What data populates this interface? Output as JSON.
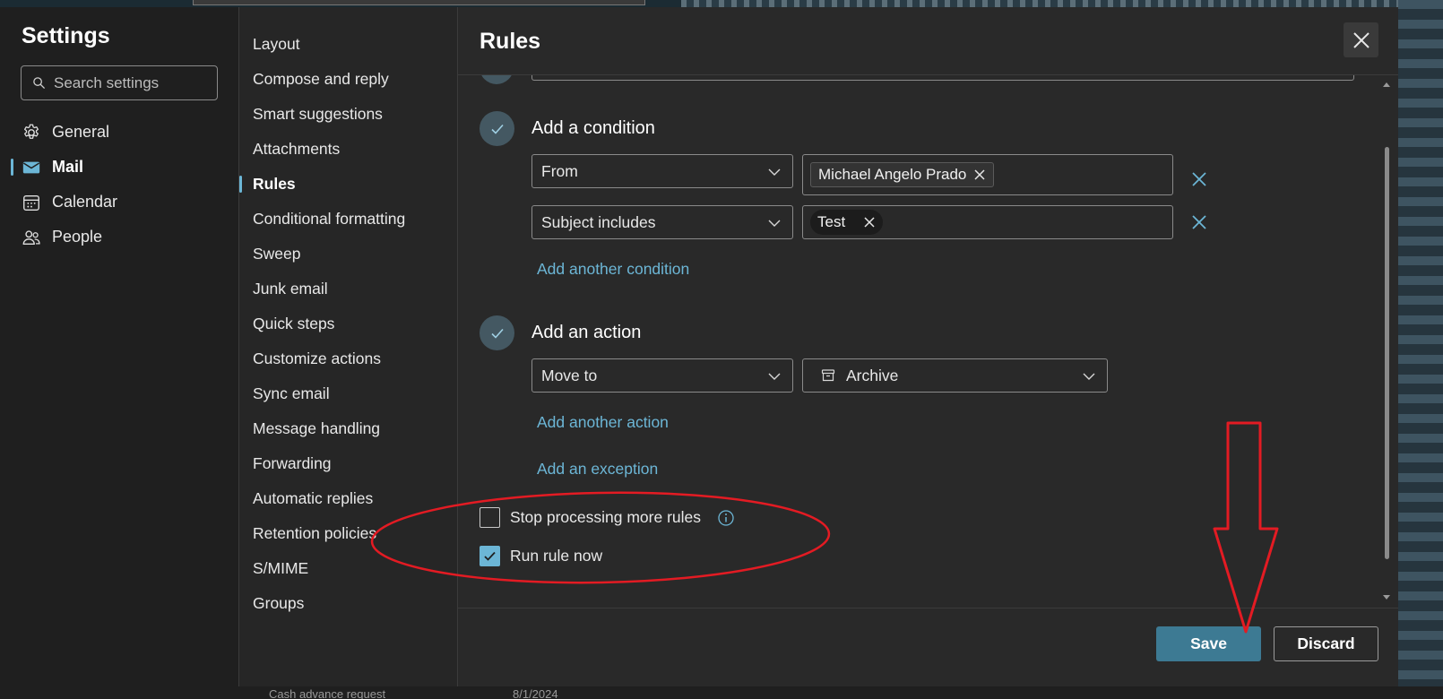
{
  "background": {
    "row_text": "Cash advance request",
    "row_date": "8/1/2024"
  },
  "nav1": {
    "title": "Settings",
    "search_placeholder": "Search settings",
    "items": [
      {
        "label": "General",
        "icon": "gear-icon"
      },
      {
        "label": "Mail",
        "icon": "mail-icon",
        "active": true
      },
      {
        "label": "Calendar",
        "icon": "calendar-icon"
      },
      {
        "label": "People",
        "icon": "people-icon"
      }
    ]
  },
  "nav2": {
    "items": [
      "Layout",
      "Compose and reply",
      "Smart suggestions",
      "Attachments",
      "Rules",
      "Conditional formatting",
      "Sweep",
      "Junk email",
      "Quick steps",
      "Customize actions",
      "Sync email",
      "Message handling",
      "Forwarding",
      "Automatic replies",
      "Retention policies",
      "S/MIME",
      "Groups"
    ],
    "active": "Rules"
  },
  "content": {
    "title": "Rules",
    "condition": {
      "heading": "Add a condition",
      "rows": [
        {
          "field": "From",
          "value": "Michael Angelo Prado"
        },
        {
          "field": "Subject includes",
          "value": "Test"
        }
      ],
      "add_link": "Add another condition"
    },
    "action": {
      "heading": "Add an action",
      "field": "Move to",
      "folder": "Archive",
      "add_link": "Add another action"
    },
    "exception_link": "Add an exception",
    "options": {
      "stop_processing": {
        "label": "Stop processing more rules",
        "checked": false
      },
      "run_now": {
        "label": "Run rule now",
        "checked": true
      }
    },
    "buttons": {
      "save": "Save",
      "discard": "Discard"
    }
  },
  "colors": {
    "accent": "#6cb6d6",
    "primary_button": "#3d7a93",
    "annotation": "#e31b23"
  }
}
